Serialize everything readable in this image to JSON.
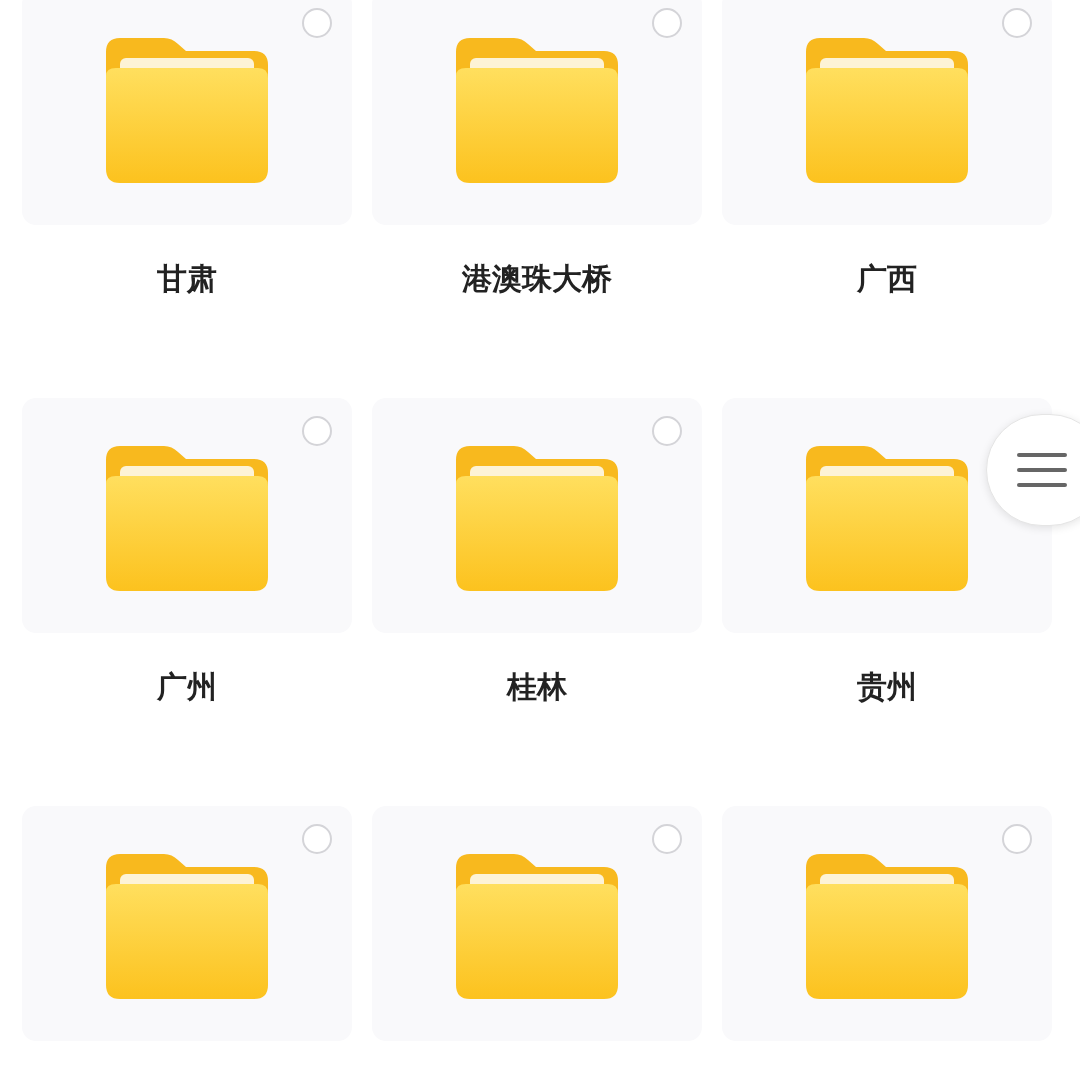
{
  "folders": [
    {
      "name": "甘肃",
      "selected": false
    },
    {
      "name": "港澳珠大桥",
      "selected": false
    },
    {
      "name": "广西",
      "selected": false
    },
    {
      "name": "广州",
      "selected": false
    },
    {
      "name": "桂林",
      "selected": false
    },
    {
      "name": "贵州"
    },
    {
      "selected": false
    },
    {
      "selected": false
    },
    {
      "selected": false
    }
  ]
}
